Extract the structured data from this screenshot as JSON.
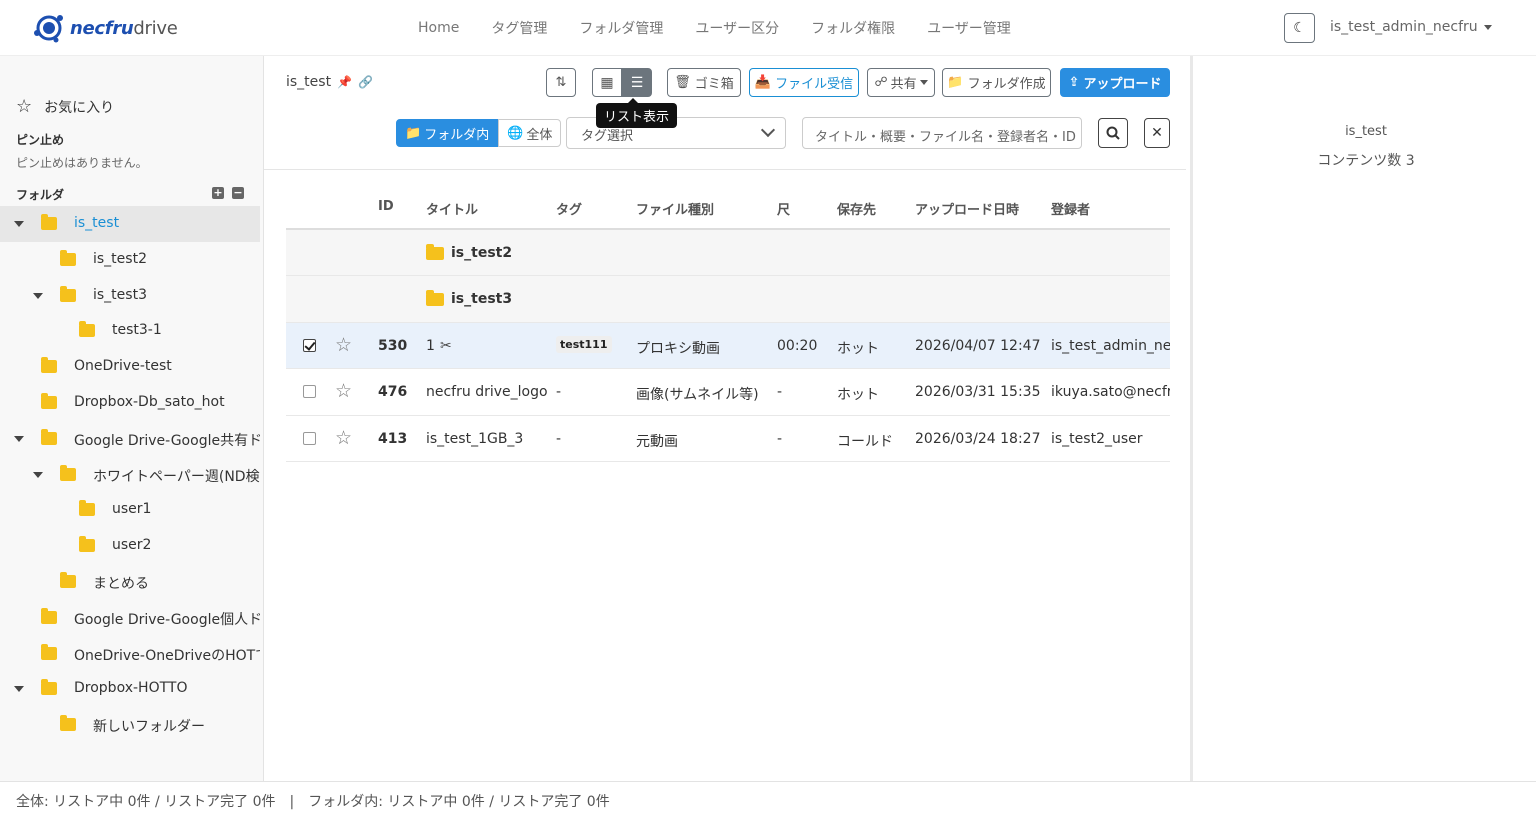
{
  "brand": {
    "name_bold": "necfru",
    "name_light": "drive"
  },
  "nav": [
    "Home",
    "タグ管理",
    "フォルダ管理",
    "ユーザー区分",
    "フォルダ権限",
    "ユーザー管理"
  ],
  "user": {
    "name": "is_test_admin_necfru"
  },
  "sidebar": {
    "favorites_label": "お気に入り",
    "pinned_title": "ピン止め",
    "pinned_empty": "ピン止めはありません。",
    "folders_title": "フォルダ",
    "expand_label": "+",
    "collapse_label": "−",
    "tree": [
      {
        "label": "is_test",
        "level": 0,
        "toggle": true,
        "active": true
      },
      {
        "label": "is_test2",
        "level": 1,
        "toggle": false
      },
      {
        "label": "is_test3",
        "level": 1,
        "toggle": true
      },
      {
        "label": "test3-1",
        "level": 2,
        "toggle": false
      },
      {
        "label": "OneDrive-test",
        "level": 0,
        "toggle": false
      },
      {
        "label": "Dropbox-Db_sato_hot",
        "level": 0,
        "toggle": false
      },
      {
        "label": "Google Drive-Google共有ドライブ",
        "level": 0,
        "toggle": true
      },
      {
        "label": "ホワイトペーパー週(ND検",
        "level": 1,
        "toggle": true
      },
      {
        "label": "user1",
        "level": 2,
        "toggle": false
      },
      {
        "label": "user2",
        "level": 2,
        "toggle": false
      },
      {
        "label": "まとめる",
        "level": 1,
        "toggle": false
      },
      {
        "label": "Google Drive-Google個人ドライブ",
        "level": 0,
        "toggle": false
      },
      {
        "label": "OneDrive-OneDriveのHOTで",
        "level": 0,
        "toggle": false
      },
      {
        "label": "Dropbox-HOTTO",
        "level": 0,
        "toggle": true
      },
      {
        "label": "新しいフォルダー",
        "level": 1,
        "toggle": false
      }
    ]
  },
  "toolbar": {
    "current_folder": "is_test",
    "trash_label": "ゴミ箱",
    "receive_label": "ファイル受信",
    "share_label": "共有",
    "create_folder_label": "フォルダ作成",
    "upload_label": "アップロード",
    "tooltip": "リスト表示",
    "scope_in_folder": "フォルダ内",
    "scope_all": "全体",
    "tag_select_placeholder": "タグ選択",
    "search_placeholder": "タイトル・概要・ファイル名・登録者名・ID"
  },
  "table": {
    "headers": {
      "id": "ID",
      "title": "タイトル",
      "tag": "タグ",
      "type": "ファイル種別",
      "duration": "尺",
      "storage": "保存先",
      "uploaded": "アップロード日時",
      "owner": "登録者"
    },
    "folders": [
      "is_test2",
      "is_test3"
    ],
    "rows": [
      {
        "checked": true,
        "id": "530",
        "title": "1",
        "tag": "test111",
        "type": "プロキシ動画",
        "duration": "00:20",
        "storage": "ホット",
        "uploaded": "2026/04/07 12:47",
        "owner": "is_test_admin_necfru"
      },
      {
        "checked": false,
        "id": "476",
        "title": "necfru drive_logo",
        "tag": "-",
        "type": "画像(サムネイル等)",
        "duration": "-",
        "storage": "ホット",
        "uploaded": "2026/03/31 15:35",
        "owner": "ikuya.sato@necfru.co.jp"
      },
      {
        "checked": false,
        "id": "413",
        "title": "is_test_1GB_3",
        "tag": "-",
        "type": "元動画",
        "duration": "-",
        "storage": "コールド",
        "uploaded": "2026/03/24 18:27",
        "owner": "is_test2_user"
      }
    ]
  },
  "right_panel": {
    "folder_name": "is_test",
    "content_count": "コンテンツ数 3"
  },
  "footer": {
    "status": "全体: リストア中 0件 / リストア完了 0件　|　フォルダ内: リストア中 0件 / リストア完了 0件"
  },
  "colors": {
    "primary": "#2a8ee0",
    "folder": "#f5c11c",
    "active_link": "#1a8fd4"
  }
}
